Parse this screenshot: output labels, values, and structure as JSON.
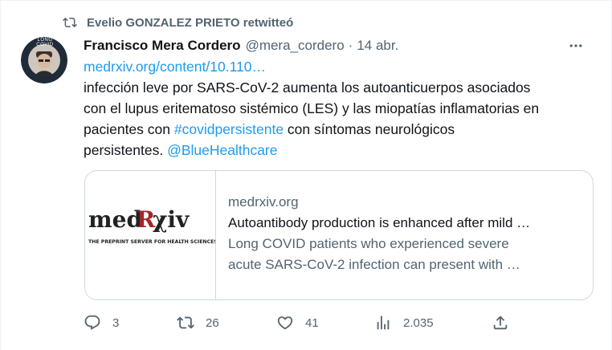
{
  "retweet_banner": {
    "text": "Evelio GONZALEZ PRIETO retwitteó"
  },
  "tweet": {
    "author_name": "Francisco Mera Cordero",
    "handle": "@mera_cordero",
    "separator": "·",
    "time": "14 abr.",
    "more_label": "···",
    "avatar_caption": "LONG COVID",
    "body": {
      "link": "medrxiv.org/content/10.110…",
      "line1": "infección leve por SARS-CoV-2 aumenta los autoanticuerpos asociados",
      "line2": "con el lupus eritematoso sistémico (LES) y las miopatías inflamatorias en",
      "line3_prefix": "pacientes con ",
      "hashtag": "#covidpersistente",
      "line3_suffix": " con síntomas neurológicos",
      "line4_prefix": "persistentes. ",
      "mention": "@BlueHealthcare"
    },
    "card": {
      "logo_text": "medRχiv",
      "logo_tagline": "THE PREPRINT SERVER FOR HEALTH SCIENCES",
      "domain": "medrxiv.org",
      "title": "Autoantibody production is enhanced after mild …",
      "description_line1": "Long COVID patients who experienced severe",
      "description_line2": "acute SARS-CoV-2 infection can present with …"
    },
    "actions": {
      "reply_count": "3",
      "retweet_count": "26",
      "like_count": "41",
      "views_count": "2.035"
    }
  },
  "colors": {
    "text_primary": "#0f1419",
    "text_secondary": "#536471",
    "link": "#1d9bf0",
    "border": "#cfd9de"
  }
}
